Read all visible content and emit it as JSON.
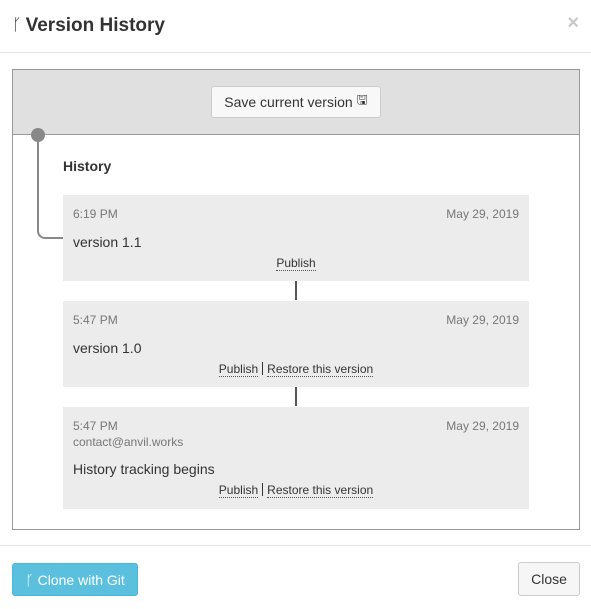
{
  "header": {
    "title": "Version History",
    "branch_icon": "ᚴ",
    "close_glyph": "×"
  },
  "toolbar": {
    "save_label": "Save current version",
    "save_icon": "🖫"
  },
  "history": {
    "label": "History",
    "versions": [
      {
        "time": "6:19 PM",
        "date": "May 29, 2019",
        "author": "",
        "description": "version 1.1",
        "publish_label": "Publish",
        "restore_label": ""
      },
      {
        "time": "5:47 PM",
        "date": "May 29, 2019",
        "author": "",
        "description": "version 1.0",
        "publish_label": "Publish",
        "restore_label": "Restore this version"
      },
      {
        "time": "5:47 PM",
        "date": "May 29, 2019",
        "author": "contact@anvil.works",
        "description": "History tracking begins",
        "publish_label": "Publish",
        "restore_label": "Restore this version"
      }
    ]
  },
  "footer": {
    "clone_label": "Clone with Git",
    "clone_icon": "ᚴ",
    "close_label": "Close"
  },
  "colors": {
    "clone_button": "#5bc0de",
    "panel_header": "#e0e0e0",
    "card_bg": "#ececec"
  }
}
